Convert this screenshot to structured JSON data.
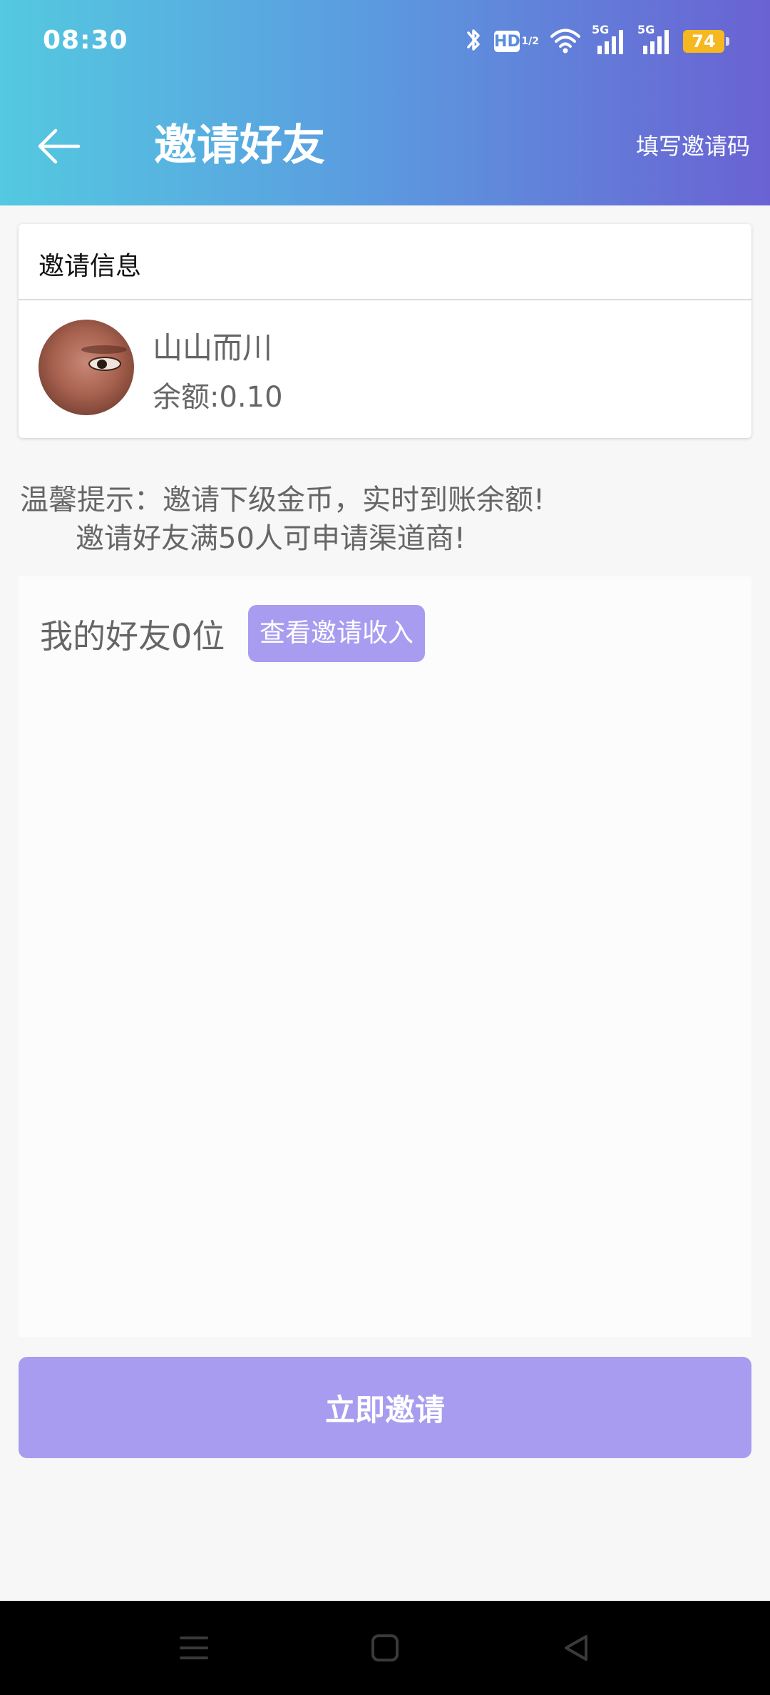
{
  "status_bar": {
    "time": "08:30",
    "hd_label": "HD",
    "hd_sub": "1/2",
    "signal1_label": "5G",
    "signal2_label": "5G",
    "battery": "74",
    "icons": [
      "bluetooth-icon",
      "hd-icon",
      "wifi-icon",
      "signal-icon",
      "signal-icon",
      "battery-icon"
    ]
  },
  "header": {
    "title": "邀请好友",
    "action_label": "填写邀请码",
    "gradient_start": "#54c9e0",
    "gradient_end": "#6a62d3"
  },
  "info_card": {
    "title": "邀请信息",
    "user_name": "山山而川",
    "balance": "余额:0.10"
  },
  "tips": {
    "line1": "温馨提示：邀请下级金币，实时到账余额!",
    "line2": "邀请好友满50人可申请渠道商!"
  },
  "friends": {
    "count_label": "我的好友0位",
    "income_button": "查看邀请收入"
  },
  "invite_button": {
    "label": "立即邀请",
    "color": "#a89cf0"
  },
  "system_nav": {
    "icons": [
      "menu-icon",
      "home-icon",
      "back-triangle-icon"
    ]
  }
}
